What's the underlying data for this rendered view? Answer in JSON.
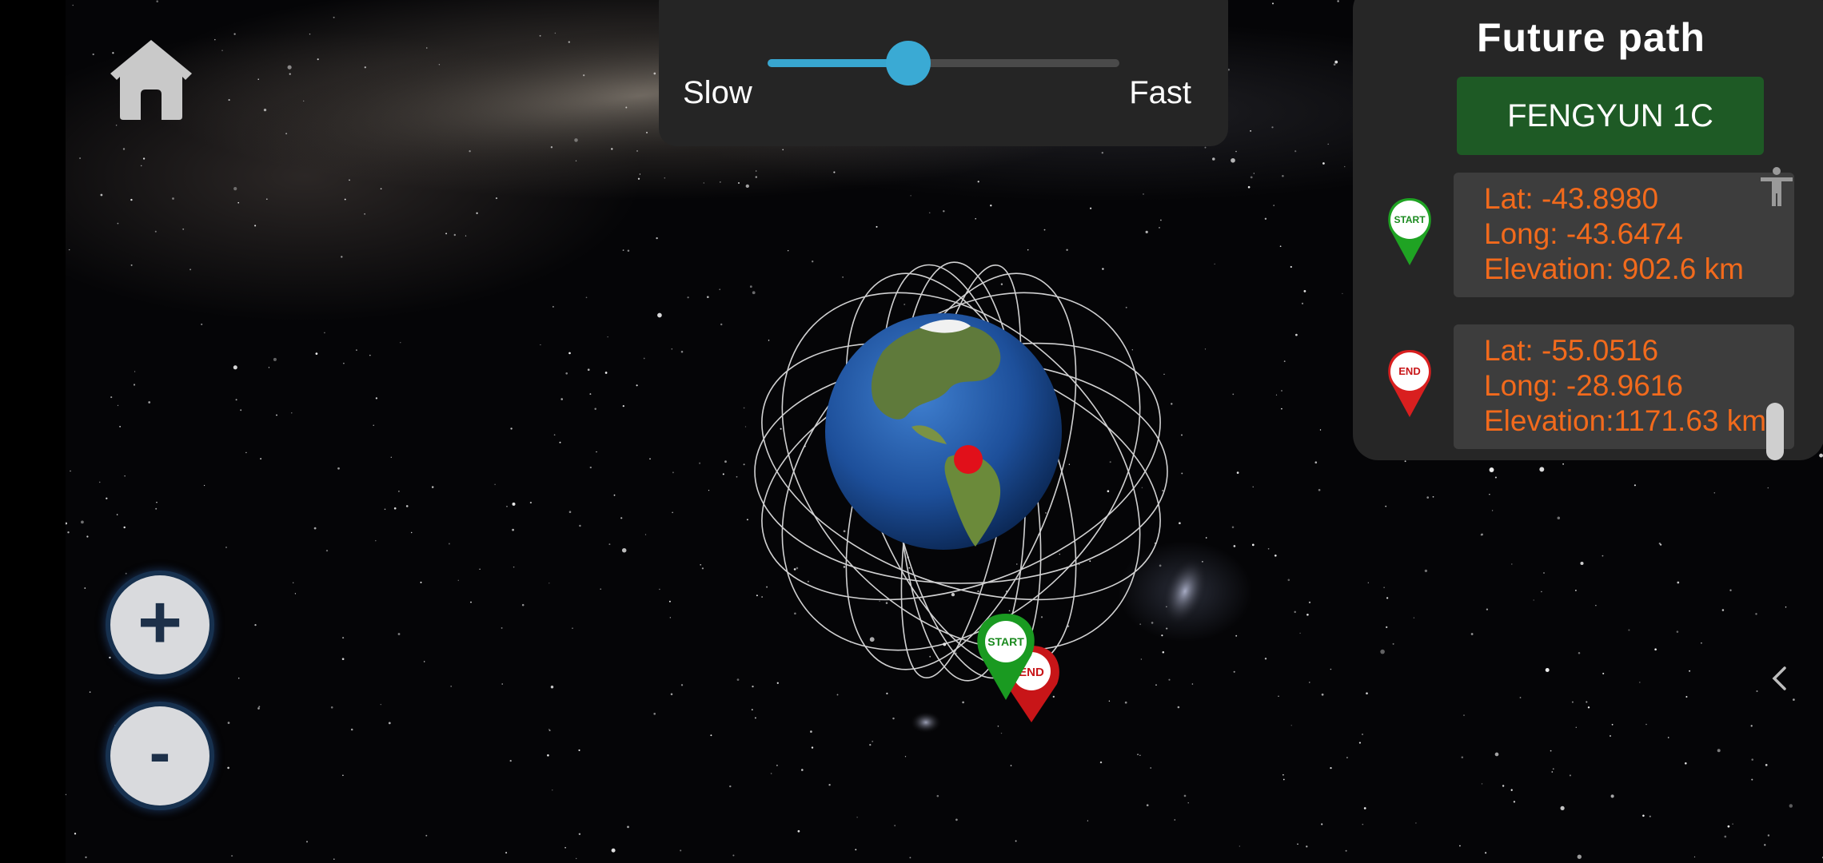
{
  "speed_control": {
    "slow_label": "Slow",
    "fast_label": "Fast",
    "value": 0.4
  },
  "info_panel": {
    "title": "Future path",
    "satellite_name": "FENGYUN 1C",
    "start": {
      "pin_label": "START",
      "lat": "Lat: -43.8980",
      "long": "Long: -43.6474",
      "elevation": "Elevation: 902.6 km"
    },
    "end": {
      "pin_label": "END",
      "lat": "Lat: -55.0516",
      "long": "Long: -28.9616",
      "elevation": "Elevation:1171.63 km"
    }
  },
  "zoom": {
    "in_label": "+",
    "out_label": "-"
  },
  "globe_markers": {
    "start_label": "START",
    "end_label": "END"
  },
  "icons": [
    "home-icon",
    "zoom-in-icon",
    "zoom-out-icon",
    "start-pin-icon",
    "end-pin-icon",
    "accessibility-icon",
    "chevron-left-icon"
  ],
  "colors": {
    "accent": "#38a6d0",
    "satellite_button": "#1e5a25",
    "coordinate_text": "#f26a1c",
    "start_pin": "#1fa323",
    "end_pin": "#d91f1f"
  }
}
